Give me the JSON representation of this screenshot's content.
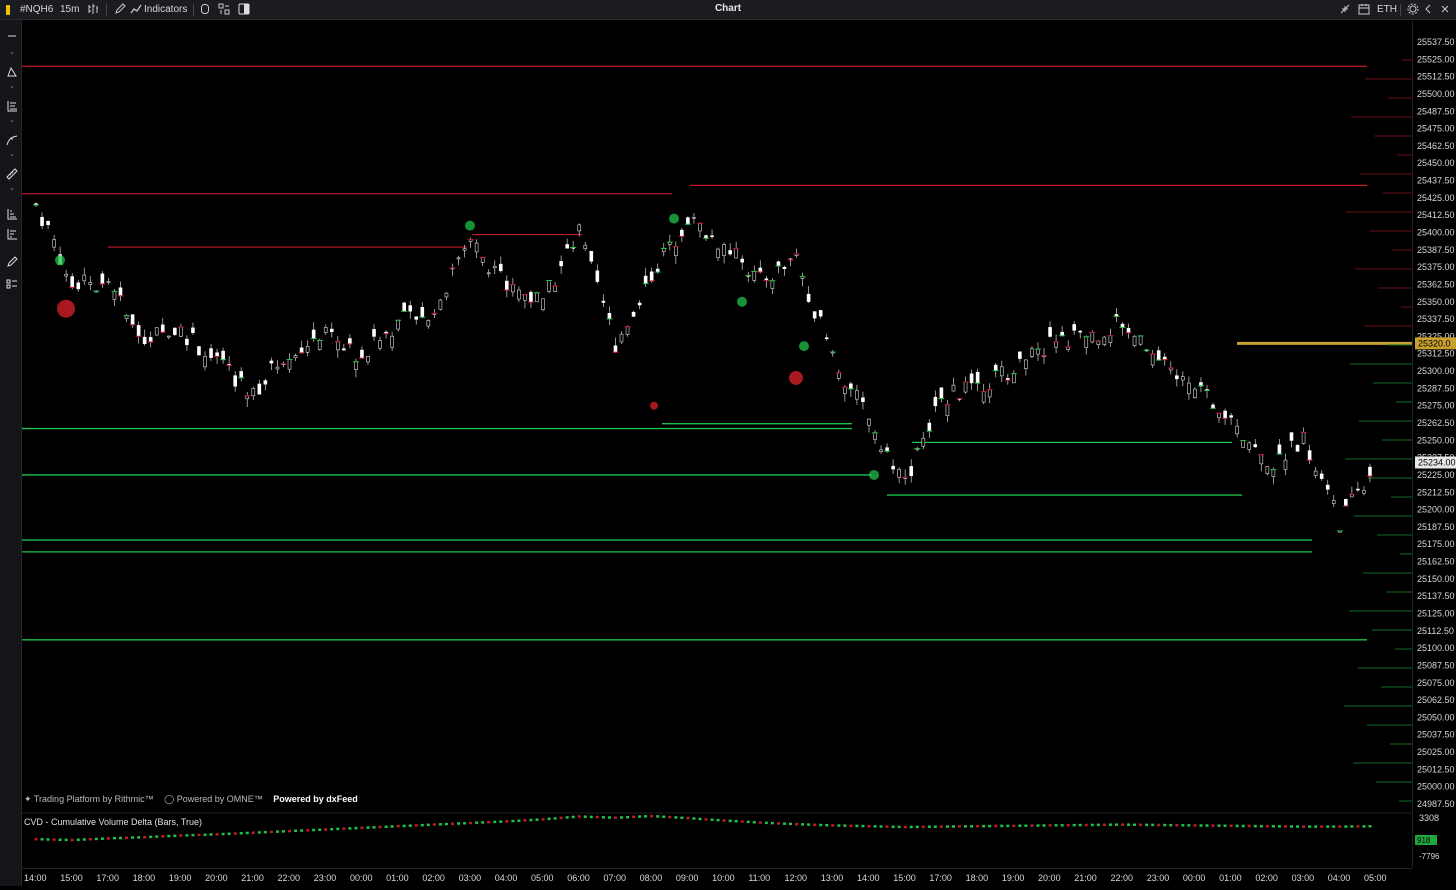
{
  "toolbar": {
    "symbol": "#NQH6",
    "timeframe": "15m",
    "indicators_label": "Indicators",
    "title": "Chart",
    "session": "ETH",
    "accent": "#f2c200"
  },
  "left_tools": [
    "line-tool-icon",
    "triangle-tool-icon",
    "fib-tool-icon",
    "curve-tool-icon",
    "ruler-icon",
    "sort-up-icon",
    "sort-down-icon",
    "brush-icon",
    "list-icon"
  ],
  "credits": {
    "rithmic": "Trading Platform by Rithmic™",
    "omne": "Powered by OMNE™",
    "dxfeed": "Powered by dxFeed"
  },
  "cvd": {
    "label": "CVD - Cumulative Volume Delta (Bars, True)",
    "top_value": "3308",
    "current_badge": "918",
    "low_value": "-7796"
  },
  "price_axis": {
    "labels": [
      "25537.50",
      "25525.00",
      "25512.50",
      "25500.00",
      "25487.50",
      "25475.00",
      "25462.50",
      "25450.00",
      "25437.50",
      "25425.00",
      "25412.50",
      "25400.00",
      "25387.50",
      "25375.00",
      "25362.50",
      "25350.00",
      "25337.50",
      "25325.00",
      "25312.50",
      "25300.00",
      "25287.50",
      "25275.00",
      "25262.50",
      "25250.00",
      "25237.50",
      "25225.00",
      "25212.50",
      "25200.00",
      "25187.50",
      "25175.00",
      "25162.50",
      "25150.00",
      "25137.50",
      "25125.00",
      "25112.50",
      "25100.00",
      "25087.50",
      "25075.00",
      "25062.50",
      "25050.00",
      "25037.50",
      "25025.00",
      "25012.50",
      "25000.00",
      "24987.50"
    ],
    "current_price": "25234.00",
    "level_badge": "25320.0",
    "level_color": "#c8a030"
  },
  "time_axis": [
    "14:00",
    "15:00",
    "17:00",
    "18:00",
    "19:00",
    "20:00",
    "21:00",
    "22:00",
    "23:00",
    "00:00",
    "01:00",
    "02:00",
    "03:00",
    "04:00",
    "05:00",
    "06:00",
    "07:00",
    "08:00",
    "09:00",
    "10:00",
    "11:00",
    "12:00",
    "13:00",
    "14:00",
    "15:00",
    "17:00",
    "18:00",
    "19:00",
    "20:00",
    "21:00",
    "22:00",
    "23:00",
    "00:00",
    "01:00",
    "02:00",
    "03:00",
    "04:00",
    "05:00"
  ],
  "colors": {
    "resistance": "#c0192a",
    "support": "#1fc14a",
    "bg": "#000000"
  },
  "chart_data": {
    "type": "line",
    "title": "",
    "resistance_levels": [
      25520.0,
      25428.0,
      25389.5,
      25398.5,
      25434.0
    ],
    "support_levels": [
      25258.5,
      25225.0,
      25178.0,
      25169.5,
      25106.0,
      25262.0,
      25248.5,
      25210.5
    ],
    "key_level": 25320.0,
    "close_path": {
      "x": [
        "14:00",
        "15:00",
        "17:00",
        "18:00",
        "19:00",
        "20:00",
        "21:00",
        "22:00",
        "23:00",
        "00:00",
        "01:00",
        "02:00",
        "03:00",
        "04:00",
        "05:00",
        "06:00",
        "07:00",
        "08:00",
        "09:00",
        "10:00",
        "11:00",
        "12:00",
        "13:00",
        "14:00",
        "15:00",
        "17:00",
        "18:00",
        "19:00",
        "20:00",
        "21:00",
        "22:00",
        "23:00",
        "00:00",
        "01:00",
        "02:00",
        "03:00",
        "04:00",
        "05:00"
      ],
      "y": [
        25420,
        25365,
        25360,
        25325,
        25330,
        25305,
        25285,
        25315,
        25325,
        25310,
        25335,
        25345,
        25395,
        25360,
        25350,
        25400,
        25320,
        25370,
        25410,
        25390,
        25365,
        25380,
        25310,
        25265,
        25220,
        25280,
        25290,
        25300,
        25320,
        25325,
        25335,
        25305,
        25285,
        25270,
        25230,
        25250,
        25190,
        25235
      ]
    },
    "cvd_path": [
      -2600,
      -2800,
      -2400,
      -2100,
      -1700,
      -1400,
      -1000,
      -600,
      -200,
      200,
      600,
      1000,
      1400,
      1800,
      2300,
      3000,
      2700,
      3100,
      2600,
      2000,
      1500,
      1100,
      800,
      600,
      400,
      500,
      600,
      700,
      800,
      900,
      1000,
      900,
      800,
      700,
      600,
      500,
      500,
      600
    ],
    "ylim": [
      24987.5,
      25537.5
    ]
  }
}
